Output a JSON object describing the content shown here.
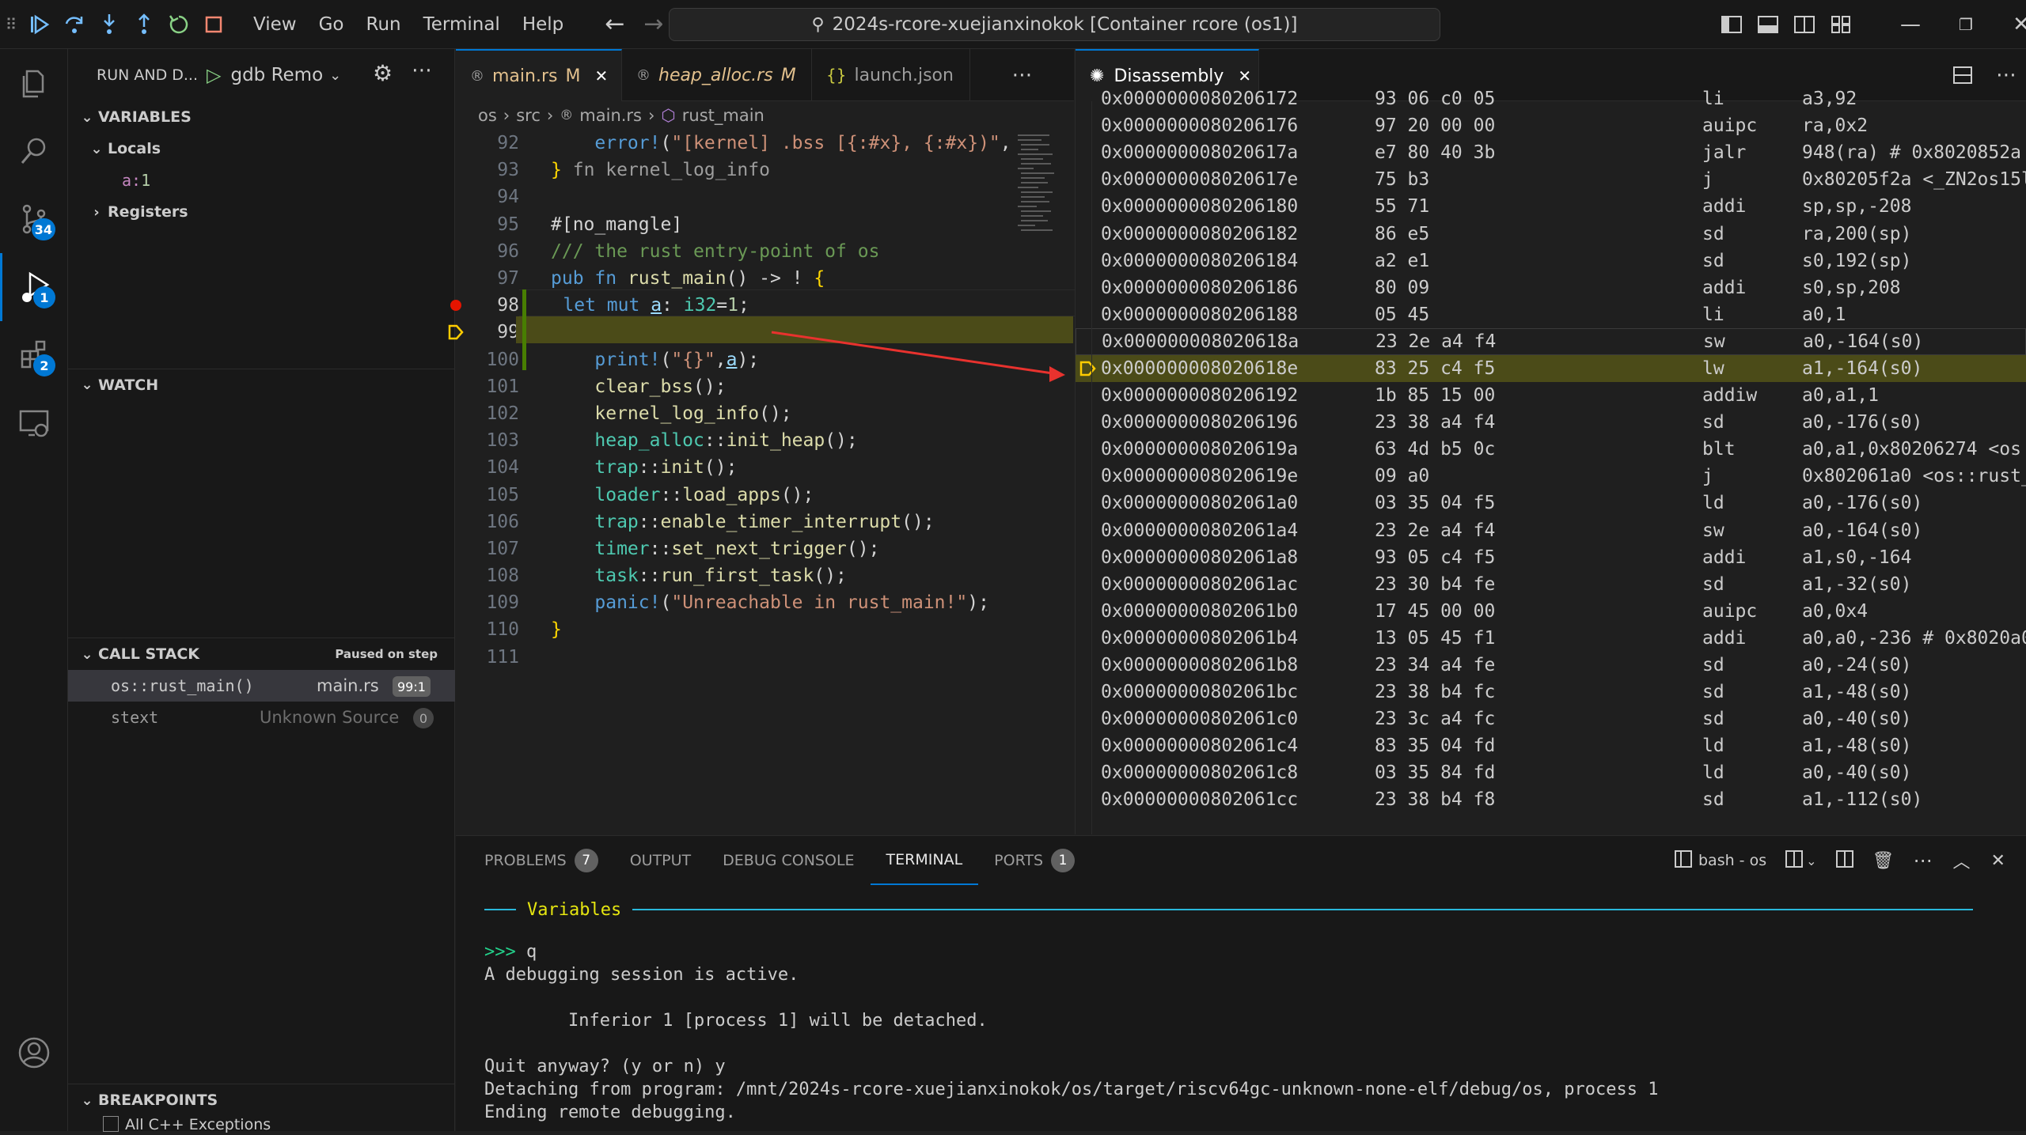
{
  "titlebar": {
    "menus": [
      "View",
      "Go",
      "Run",
      "Terminal",
      "Help"
    ],
    "command_center": "2024s-rcore-xuejianxinokok [Container rcore (os1)]"
  },
  "activity": {
    "scm_badge": "34",
    "debug_badge": "1",
    "extensions_badge": "2"
  },
  "sidebar": {
    "title": "RUN AND D...",
    "config": "gdb Remo",
    "variables_title": "VARIABLES",
    "locals_label": "Locals",
    "local_var_name": "a",
    "local_var_value": "1",
    "registers_label": "Registers",
    "watch_title": "WATCH",
    "callstack_title": "CALL STACK",
    "callstack_status": "Paused on step",
    "frames": [
      {
        "name": "os::rust_main()",
        "file": "main.rs",
        "pos": "99:1"
      },
      {
        "name": "stext",
        "file": "Unknown Source",
        "pos": "0"
      }
    ],
    "breakpoints_title": "BREAKPOINTS",
    "breakpoint_item": "All C++ Exceptions"
  },
  "editor": {
    "tabs": [
      {
        "label": "main.rs",
        "mod": "M"
      },
      {
        "label": "heap_alloc.rs",
        "mod": "M"
      },
      {
        "label": "launch.json",
        "mod": ""
      }
    ],
    "breadcrumb": [
      "os",
      "src",
      "main.rs",
      "rust_main"
    ],
    "line_numbers": [
      "92",
      "93",
      "94",
      "95",
      "96",
      "97",
      "98",
      "99",
      "100",
      "101",
      "102",
      "103",
      "104",
      "105",
      "106",
      "107",
      "108",
      "109",
      "110",
      "111"
    ]
  },
  "disassembly": {
    "tab_label": "Disassembly",
    "rows": [
      {
        "addr": "0x0000000080206172",
        "bytes": "93 06 c0 05",
        "op": "li",
        "args": "a3,92"
      },
      {
        "addr": "0x0000000080206176",
        "bytes": "97 20 00 00",
        "op": "auipc",
        "args": "ra,0x2"
      },
      {
        "addr": "0x000000008020617a",
        "bytes": "e7 80 40 3b",
        "op": "jalr",
        "args": "948(ra) # 0x8020852a"
      },
      {
        "addr": "0x000000008020617e",
        "bytes": "75 b3",
        "op": "j",
        "args": "0x80205f2a <_ZN2os15l"
      },
      {
        "addr": "0x0000000080206180",
        "bytes": "55 71",
        "op": "addi",
        "args": "sp,sp,-208"
      },
      {
        "addr": "0x0000000080206182",
        "bytes": "86 e5",
        "op": "sd",
        "args": "ra,200(sp)"
      },
      {
        "addr": "0x0000000080206184",
        "bytes": "a2 e1",
        "op": "sd",
        "args": "s0,192(sp)"
      },
      {
        "addr": "0x0000000080206186",
        "bytes": "80 09",
        "op": "addi",
        "args": "s0,sp,208"
      },
      {
        "addr": "0x0000000080206188",
        "bytes": "05 45",
        "op": "li",
        "args": "a0,1"
      },
      {
        "addr": "0x000000008020618a",
        "bytes": "23 2e a4 f4",
        "op": "sw",
        "args": "a0,-164(s0)"
      },
      {
        "addr": "0x000000008020618e",
        "bytes": "83 25 c4 f5",
        "op": "lw",
        "args": "a1,-164(s0)"
      },
      {
        "addr": "0x0000000080206192",
        "bytes": "1b 85 15 00",
        "op": "addiw",
        "args": "a0,a1,1"
      },
      {
        "addr": "0x0000000080206196",
        "bytes": "23 38 a4 f4",
        "op": "sd",
        "args": "a0,-176(s0)"
      },
      {
        "addr": "0x000000008020619a",
        "bytes": "63 4d b5 0c",
        "op": "blt",
        "args": "a0,a1,0x80206274 <os"
      },
      {
        "addr": "0x000000008020619e",
        "bytes": "09 a0",
        "op": "j",
        "args": "0x802061a0 <os::rust_"
      },
      {
        "addr": "0x00000000802061a0",
        "bytes": "03 35 04 f5",
        "op": "ld",
        "args": "a0,-176(s0)"
      },
      {
        "addr": "0x00000000802061a4",
        "bytes": "23 2e a4 f4",
        "op": "sw",
        "args": "a0,-164(s0)"
      },
      {
        "addr": "0x00000000802061a8",
        "bytes": "93 05 c4 f5",
        "op": "addi",
        "args": "a1,s0,-164"
      },
      {
        "addr": "0x00000000802061ac",
        "bytes": "23 30 b4 fe",
        "op": "sd",
        "args": "a1,-32(s0)"
      },
      {
        "addr": "0x00000000802061b0",
        "bytes": "17 45 00 00",
        "op": "auipc",
        "args": "a0,0x4"
      },
      {
        "addr": "0x00000000802061b4",
        "bytes": "13 05 45 f1",
        "op": "addi",
        "args": "a0,a0,-236 # 0x8020a0"
      },
      {
        "addr": "0x00000000802061b8",
        "bytes": "23 34 a4 fe",
        "op": "sd",
        "args": "a0,-24(s0)"
      },
      {
        "addr": "0x00000000802061bc",
        "bytes": "23 38 b4 fc",
        "op": "sd",
        "args": "a1,-48(s0)"
      },
      {
        "addr": "0x00000000802061c0",
        "bytes": "23 3c a4 fc",
        "op": "sd",
        "args": "a0,-40(s0)"
      },
      {
        "addr": "0x00000000802061c4",
        "bytes": "83 35 04 fd",
        "op": "ld",
        "args": "a1,-48(s0)"
      },
      {
        "addr": "0x00000000802061c8",
        "bytes": "03 35 84 fd",
        "op": "ld",
        "args": "a0,-40(s0)"
      },
      {
        "addr": "0x00000000802061cc",
        "bytes": "23 38 b4 f8",
        "op": "sd",
        "args": "a1,-112(s0)"
      }
    ]
  },
  "panel": {
    "tabs": [
      "PROBLEMS",
      "OUTPUT",
      "DEBUG CONSOLE",
      "TERMINAL",
      "PORTS"
    ],
    "problems_count": "7",
    "ports_count": "1",
    "terminal_name": "bash - os",
    "term_section": "Variables",
    "lines": [
      ">>> q",
      "A debugging session is active.",
      "",
      "        Inferior 1 [process 1] will be detached.",
      "",
      "Quit anyway? (y or n) y",
      "Detaching from program: /mnt/2024s-rcore-xuejianxinokok/os/target/riscv64gc-unknown-none-elf/debug/os, process 1",
      "Ending remote debugging."
    ]
  },
  "colors": {
    "accent": "#0078d4",
    "breakpoint": "#e51400",
    "current_line": "#4b4b18",
    "arrow": "#e8322e"
  }
}
